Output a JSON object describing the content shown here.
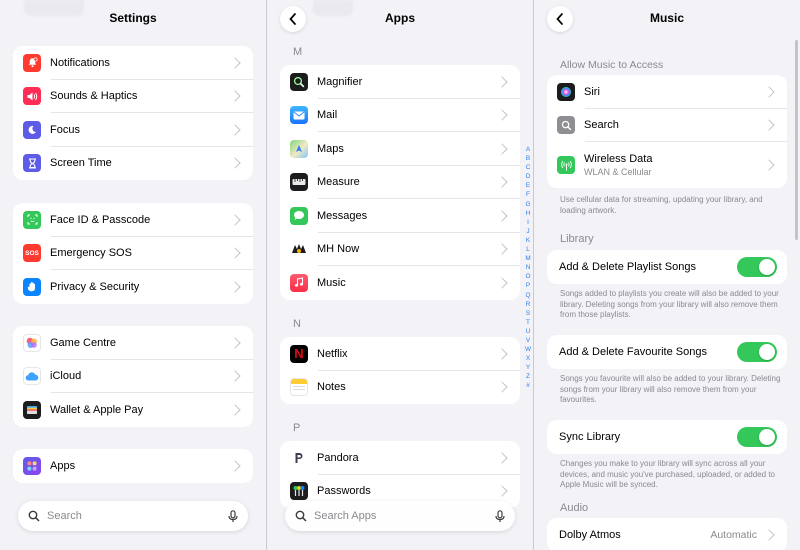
{
  "settings": {
    "title": "Settings",
    "groups": [
      [
        {
          "label": "Notifications",
          "icon": "bell-icon",
          "color": "#ff3b30"
        },
        {
          "label": "Sounds & Haptics",
          "icon": "speaker-icon",
          "color": "#ff2d55"
        },
        {
          "label": "Focus",
          "icon": "moon-icon",
          "color": "#5e5ce6"
        },
        {
          "label": "Screen Time",
          "icon": "hourglass-icon",
          "color": "#5e5ce6"
        }
      ],
      [
        {
          "label": "Face ID & Passcode",
          "icon": "face-id-icon",
          "color": "#34c759"
        },
        {
          "label": "Emergency SOS",
          "icon": "sos-icon",
          "color": "#ff3b30"
        },
        {
          "label": "Privacy & Security",
          "icon": "hand-icon",
          "color": "#0a84ff"
        }
      ],
      [
        {
          "label": "Game Centre",
          "icon": "game-centre-icon",
          "color": "#ffffff"
        },
        {
          "label": "iCloud",
          "icon": "cloud-icon",
          "color": "#ffffff"
        },
        {
          "label": "Wallet & Apple Pay",
          "icon": "wallet-icon",
          "color": "#1c1c1e"
        }
      ],
      [
        {
          "label": "Apps",
          "icon": "apps-grid-icon",
          "color": "#5e5ce6"
        }
      ]
    ],
    "search_placeholder": "Search"
  },
  "apps": {
    "title": "Apps",
    "sections": [
      {
        "letter": "M",
        "items": [
          {
            "label": "Magnifier",
            "icon": "magnifier-icon",
            "color": "#1c1c1e"
          },
          {
            "label": "Mail",
            "icon": "mail-icon",
            "color": "#1e88ff"
          },
          {
            "label": "Maps",
            "icon": "maps-icon",
            "color": "#5ac86a"
          },
          {
            "label": "Measure",
            "icon": "measure-icon",
            "color": "#1c1c1e"
          },
          {
            "label": "Messages",
            "icon": "messages-icon",
            "color": "#34c759"
          },
          {
            "label": "MH Now",
            "icon": "mh-now-icon",
            "color": "#ffffff"
          },
          {
            "label": "Music",
            "icon": "music-icon",
            "color": "#fa2d48"
          }
        ]
      },
      {
        "letter": "N",
        "items": [
          {
            "label": "Netflix",
            "icon": "netflix-icon",
            "color": "#000000"
          },
          {
            "label": "Notes",
            "icon": "notes-icon",
            "color": "#ffffff"
          }
        ]
      },
      {
        "letter": "P",
        "items": [
          {
            "label": "Pandora",
            "icon": "pandora-icon",
            "color": "#ffffff"
          },
          {
            "label": "Passwords",
            "icon": "passwords-icon",
            "color": "#1c1c1e"
          }
        ]
      }
    ],
    "index_letters": [
      "A",
      "B",
      "C",
      "D",
      "E",
      "F",
      "G",
      "H",
      "I",
      "J",
      "K",
      "L",
      "M",
      "N",
      "O",
      "P",
      "Q",
      "R",
      "S",
      "T",
      "U",
      "V",
      "W",
      "X",
      "Y",
      "Z",
      "#"
    ],
    "search_placeholder": "Search Apps"
  },
  "music": {
    "title": "Music",
    "access_header": "Allow Music to Access",
    "access_items": [
      {
        "label": "Siri",
        "icon": "siri-icon",
        "color": "#1c1c1e"
      },
      {
        "label": "Search",
        "icon": "search-icon",
        "color": "#8e8e93"
      },
      {
        "label": "Wireless Data",
        "sub": "WLAN & Cellular",
        "icon": "antenna-icon",
        "color": "#34c759"
      }
    ],
    "access_footer": "Use cellular data for streaming, updating your library, and loading artwork.",
    "library_header": "Library",
    "toggles": [
      {
        "label": "Add & Delete Playlist Songs",
        "on": true,
        "footer": "Songs added to playlists you create will also be added to your library. Deleting songs from your library will also remove them from those playlists."
      },
      {
        "label": "Add & Delete Favourite Songs",
        "on": true,
        "footer": "Songs you favourite will also be added to your library. Deleting songs from your library will also remove them from your favourites."
      },
      {
        "label": "Sync Library",
        "on": true,
        "footer": "Changes you make to your library will sync across all your devices, and music you've purchased, uploaded, or added to Apple Music will be synced."
      }
    ],
    "audio_header": "Audio",
    "dolby": {
      "label": "Dolby Atmos",
      "value": "Automatic"
    }
  }
}
